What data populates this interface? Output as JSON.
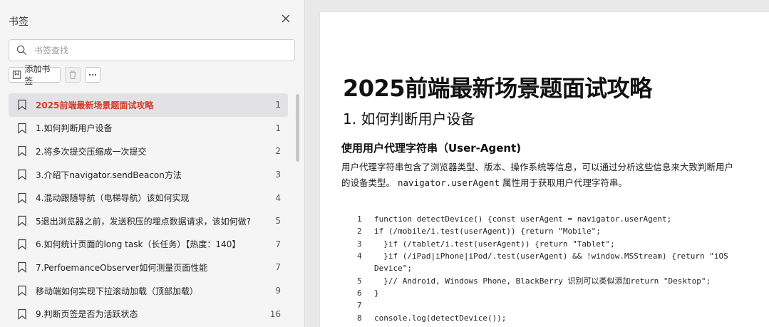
{
  "sidebar": {
    "title": "书签",
    "search_placeholder": "书签查找",
    "add_bookmark_label": "添加书签",
    "items": [
      {
        "label": "2025前端最新场景题面试攻略",
        "page": "1",
        "active": true
      },
      {
        "label": "1.如何判断用户设备",
        "page": "1"
      },
      {
        "label": "2.将多次提交压缩成一次提交",
        "page": "2"
      },
      {
        "label": "3.介绍下navigator.sendBeacon方法",
        "page": "3"
      },
      {
        "label": "4.混动跟随导航（电梯导航）该如何实现",
        "page": "4"
      },
      {
        "label": "5退出浏览器之前，发送积压的埋点数据请求，该如何做?",
        "page": "5"
      },
      {
        "label": "6.如何统计页面的long task（长任务）【热度：140】",
        "page": "7"
      },
      {
        "label": "7.PerfoemanceObserver如何测量页面性能",
        "page": "7"
      },
      {
        "label": "移动端如何实现下拉滚动加载（顶部加载）",
        "page": "9"
      },
      {
        "label": "9.判断页签是否为活跃状态",
        "page": "16"
      }
    ]
  },
  "document": {
    "title": "2025前端最新场景题面试攻略",
    "heading1": "1. 如何判断用户设备",
    "heading2": "使用用户代理字符串（User-Agent)",
    "para_line1": "用户代理字符串包含了浏览器类型、版本、操作系统等信息，可以通过分析这些信息来大致判断用户",
    "para_line2_prefix": "的设备类型。",
    "para_code": "navigator.userAgent",
    "para_line2_suffix": "属性用于获取用户代理字符串。",
    "code_lines": [
      {
        "n": "1",
        "text": "function detectDevice() {const userAgent = navigator.userAgent;"
      },
      {
        "n": "2",
        "text": "if (/mobile/i.test(userAgent)) {return \"Mobile\";"
      },
      {
        "n": "3",
        "text": "  }if (/tablet/i.test(userAgent)) {return \"Tablet\";"
      },
      {
        "n": "4",
        "text": "  }if (/iPad|iPhone|iPod/.test(userAgent) && !window.MSStream) {return \"iOS"
      },
      {
        "n": "",
        "text": "Device\";"
      },
      {
        "n": "5",
        "text": "  }// Android, Windows Phone, BlackBerry 识别可以类似添加return \"Desktop\";"
      },
      {
        "n": "6",
        "text": "}"
      },
      {
        "n": "7",
        "text": ""
      },
      {
        "n": "8",
        "text": "console.log(detectDevice());"
      }
    ]
  },
  "colors": {
    "active_text": "#d33a2c",
    "sidebar_bg": "#f5f5f6",
    "page_bg": "#e9e9ea"
  },
  "icons": [
    "close-icon",
    "search-icon",
    "add-bookmark-icon",
    "trash-icon",
    "more-icon",
    "bookmark-icon"
  ]
}
